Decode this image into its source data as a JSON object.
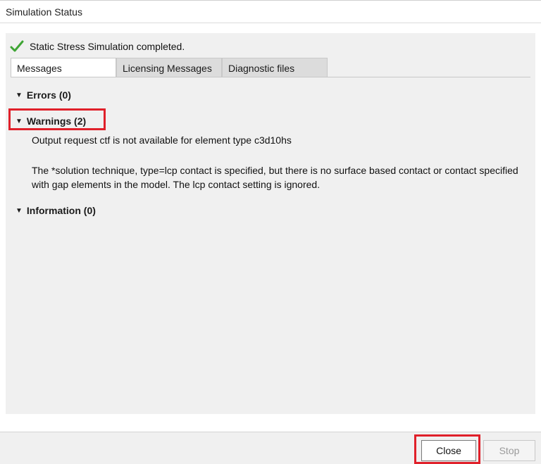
{
  "window": {
    "title": "Simulation Status"
  },
  "status": {
    "text": "Static Stress Simulation completed.",
    "icon": "check-icon",
    "color": "#3fa535"
  },
  "tabs": [
    {
      "label": "Messages",
      "active": true
    },
    {
      "label": "Licensing Messages",
      "active": false
    },
    {
      "label": "Diagnostic files",
      "active": false
    }
  ],
  "sections": {
    "errors": {
      "label": "Errors (0)",
      "expanded": true
    },
    "warnings": {
      "label": "Warnings (2)",
      "expanded": true,
      "messages": [
        "Output request ctf is not available for element type c3d10hs",
        "The *solution technique, type=lcp contact is specified, but there is no surface based contact  or contact specified with gap elements in the model. The lcp contact setting is ignored."
      ]
    },
    "information": {
      "label": "Information (0)",
      "expanded": true
    }
  },
  "buttons": {
    "close": "Close",
    "stop": "Stop"
  },
  "highlight_color": "#e0202a"
}
